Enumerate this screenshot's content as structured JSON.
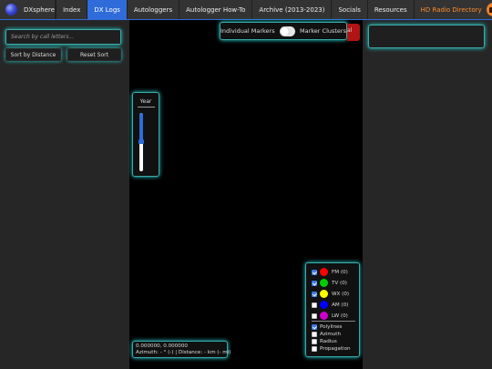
{
  "nav": {
    "brand": "DXsphere",
    "items": [
      {
        "label": "Index",
        "active": false
      },
      {
        "label": "DX Logs",
        "active": true
      },
      {
        "label": "Autologgers",
        "active": false
      },
      {
        "label": "Autologger How-To",
        "active": false
      },
      {
        "label": "Archive (2013-2023)",
        "active": false
      },
      {
        "label": "Socials",
        "active": false
      },
      {
        "label": "Resources",
        "active": false
      }
    ],
    "hd_radio": "HD Radio Directory",
    "folder_icon": "folder-icon"
  },
  "sidebar": {
    "search_placeholder": "Search by call letters...",
    "sort_label": "Sort by Distance",
    "reset_label": "Reset Sort"
  },
  "map": {
    "toggle": {
      "left_label": "Individual Markers",
      "right_label": "Marker Clusters",
      "clusters_on": false
    },
    "red_tab_text": "al",
    "year_label": "Year",
    "year_slider_fraction": 0.48,
    "coords": "0.000000, 0.000000",
    "azimuth_line": "Azimuth: - ° (-) | Distance: - km (- mi)",
    "legend": {
      "bands": [
        {
          "label": "FM (0)",
          "color": "#ff0000",
          "checked": true
        },
        {
          "label": "TV (0)",
          "color": "#00cc00",
          "checked": true
        },
        {
          "label": "WX (0)",
          "color": "#ffff00",
          "checked": true
        },
        {
          "label": "AM (0)",
          "color": "#0000ff",
          "checked": false
        },
        {
          "label": "LW (0)",
          "color": "#cc00cc",
          "checked": false
        }
      ],
      "options": [
        {
          "label": "Polylines",
          "checked": true
        },
        {
          "label": "Azimuth",
          "checked": false
        },
        {
          "label": "Radius",
          "checked": false
        },
        {
          "label": "Propagation",
          "checked": false
        }
      ]
    }
  },
  "colors": {
    "accent": "#2f6bd9",
    "glow": "#27d4d4",
    "hd_radio": "#ff8a2a"
  }
}
